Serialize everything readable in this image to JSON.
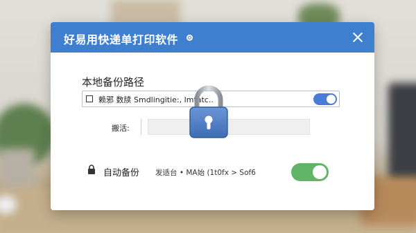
{
  "window": {
    "title": "好易用快递单打印软件"
  },
  "backup": {
    "section_label": "本地备份路径",
    "path_text": "赖邪 数牍 Smdlingitie:, lmtatc..",
    "path_toggle_on": true
  },
  "field": {
    "label": "搬活:",
    "value": ""
  },
  "auto_backup": {
    "label": "自动备份",
    "info": "发适台 • MA始 (1t0fx > Sof6",
    "toggle_on": true
  },
  "colors": {
    "title_bar": "#3f7fd0",
    "path_toggle": "#4a7bd6",
    "auto_toggle": "#62b566",
    "lock_body": "#4a78c0"
  },
  "icons": {
    "title_indicator": "radio-dot-icon",
    "close": "close-icon",
    "checkbox": "checkbox-icon",
    "auto_backup": "lock-icon",
    "overlay": "padlock-icon"
  }
}
